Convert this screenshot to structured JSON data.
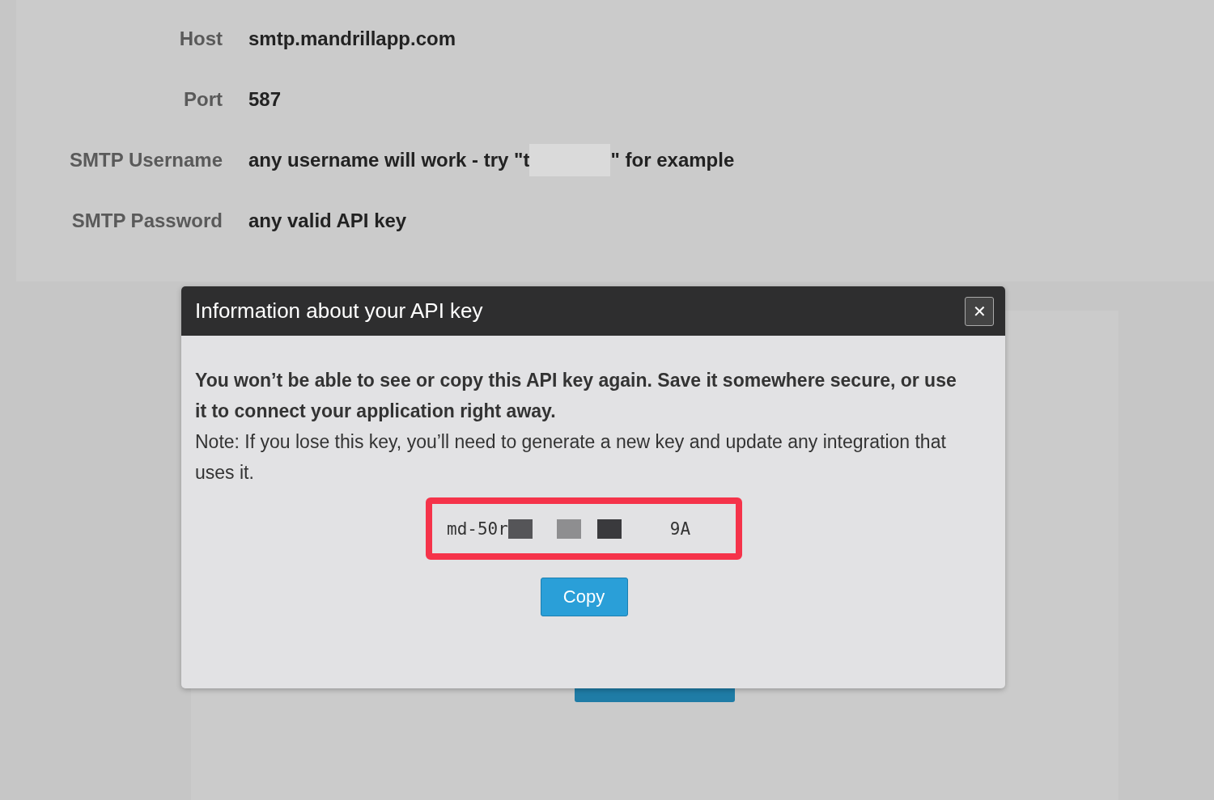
{
  "settings": [
    {
      "label": "Host",
      "value": "smtp.mandrillapp.com"
    },
    {
      "label": "Port",
      "value": "587"
    },
    {
      "label": "SMTP Username",
      "value": "any username will work - try \"t",
      "value_after": "\" for example",
      "redacted": true
    },
    {
      "label": "SMTP Password",
      "value": "any valid API key"
    }
  ],
  "dialog": {
    "title": "Information about your API key",
    "close": "✕",
    "warning": "You won’t be able to see or copy this API key again. Save it somewhere secure, or use it to connect your application right away.",
    "note": "Note: If you lose this key, you’ll need to generate a new key and update any integration that uses it.",
    "key_start": "md-50r",
    "key_end": "9A",
    "copy_button": "Copy"
  }
}
